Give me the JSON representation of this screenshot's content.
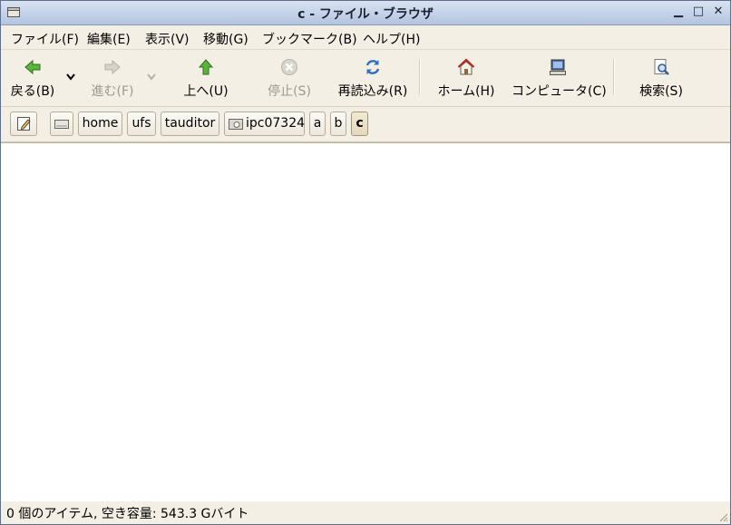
{
  "window": {
    "title": "c - ファイル・ブラウザ"
  },
  "menubar": {
    "items": [
      "ファイル(F)",
      "編集(E)",
      "表示(V)",
      "移動(G)",
      "ブックマーク(B)",
      "ヘルプ(H)"
    ]
  },
  "toolbar": {
    "back": "戻る(B)",
    "forward": "進む(F)",
    "up": "上へ(U)",
    "stop": "停止(S)",
    "reload": "再読込み(R)",
    "home": "ホーム(H)",
    "computer": "コンピュータ(C)",
    "search": "検索(S)"
  },
  "path": {
    "segments": [
      "home",
      "ufs",
      "tauditor",
      "ipc07324",
      "a",
      "b",
      "c"
    ]
  },
  "status": {
    "text": "0 個のアイテム, 空き容量: 543.3 Gバイト"
  },
  "colors": {
    "title_bar": "#b3c4e0",
    "chrome": "#f3efe4",
    "content": "#ffffff"
  }
}
